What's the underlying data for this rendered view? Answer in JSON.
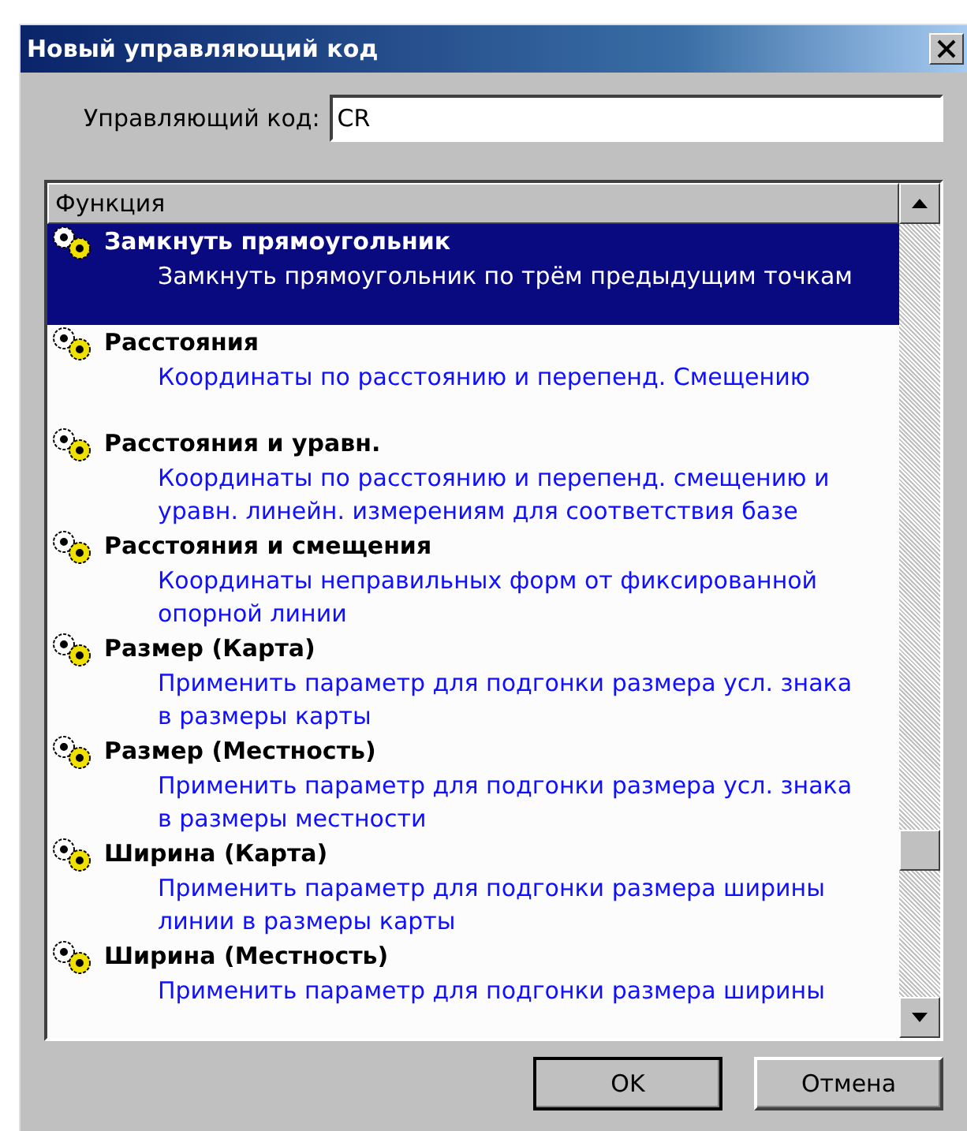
{
  "window": {
    "title": "Новый управляющий код"
  },
  "code_field": {
    "label": "Управляющий код:",
    "value": "CR"
  },
  "list": {
    "column": "Функция",
    "items": [
      {
        "title": "Замкнуть прямоугольник",
        "description": "Замкнуть прямоугольник по трём предыдущим точкам",
        "selected": true
      },
      {
        "title": "Расстояния",
        "description": "Координаты по расстоянию и перепенд. Смещению",
        "selected": false
      },
      {
        "title": "Расстояния и уравн.",
        "description": "Координаты по расстоянию и перепенд. смещению и уравн. линейн. измерениям для соответствия базе",
        "selected": false
      },
      {
        "title": "Расстояния и смещения",
        "description": "Координаты неправильных форм от фиксированной опорной линии",
        "selected": false
      },
      {
        "title": "Размер (Карта)",
        "description": "Применить параметр для подгонки размера усл. знака в размеры карты",
        "selected": false
      },
      {
        "title": "Размер (Местность)",
        "description": "Применить параметр для подгонки размера усл. знака в размеры местности",
        "selected": false
      },
      {
        "title": "Ширина (Карта)",
        "description": "Применить параметр для подгонки размера ширины линии в размеры  карты",
        "selected": false
      },
      {
        "title": "Ширина (Местность)",
        "description": "Применить параметр для подгонки размера ширины",
        "selected": false
      }
    ]
  },
  "buttons": [
    "OK",
    "Отмена"
  ]
}
